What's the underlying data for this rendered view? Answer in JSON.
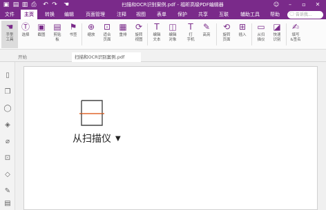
{
  "title_bar": {
    "title": "扫描和OCR识别案例.pdf - 福昕高级PDF编辑器",
    "quick_icons": [
      "app-logo-icon",
      "open-icon",
      "save-icon",
      "print-icon",
      "undo-icon",
      "redo-icon",
      "hand-icon"
    ],
    "window_controls": [
      "user-icon",
      "minimize-icon",
      "restore-icon",
      "close-icon"
    ]
  },
  "menu": {
    "items": [
      {
        "label": "文件",
        "active": false
      },
      {
        "label": "主页",
        "active": true
      },
      {
        "label": "转换",
        "active": false
      },
      {
        "label": "编辑",
        "active": false
      },
      {
        "label": "页面管理",
        "active": false
      },
      {
        "label": "注释",
        "active": false
      },
      {
        "label": "视图",
        "active": false
      },
      {
        "label": "表单",
        "active": false
      },
      {
        "label": "保护",
        "active": false
      },
      {
        "label": "共享",
        "active": false
      },
      {
        "label": "互联",
        "active": false
      },
      {
        "label": "辅助工具",
        "active": false
      },
      {
        "label": "帮助",
        "active": false
      }
    ],
    "search_placeholder": "告诉我..."
  },
  "ribbon": {
    "buttons": [
      {
        "icon": "hand-tool-icon",
        "label1": "手型",
        "label2": "工具",
        "selected": true
      },
      {
        "icon": "select-icon",
        "label1": "选择",
        "label2": "",
        "selected": false
      },
      {
        "icon": "snapshot-icon",
        "label1": "截图",
        "label2": "",
        "selected": false
      },
      {
        "icon": "clipboard-icon",
        "label1": "剪贴",
        "label2": "板",
        "selected": false
      },
      {
        "icon": "bookmark-icon",
        "label1": "书签",
        "label2": "",
        "selected": false
      },
      {
        "icon": "zoom-icon",
        "label1": "缩放",
        "label2": "",
        "selected": false
      },
      {
        "icon": "fit-page-icon",
        "label1": "适合",
        "label2": "页面",
        "selected": false
      },
      {
        "icon": "reflow-icon",
        "label1": "重排",
        "label2": "",
        "selected": false
      },
      {
        "icon": "rotate-view-icon",
        "label1": "旋转",
        "label2": "视图",
        "selected": false
      },
      {
        "icon": "edit-text-icon",
        "label1": "编辑",
        "label2": "文本",
        "selected": false
      },
      {
        "icon": "edit-object-icon",
        "label1": "编辑",
        "label2": "对象",
        "selected": false
      },
      {
        "icon": "typewriter-icon",
        "label1": "打",
        "label2": "字机",
        "selected": false
      },
      {
        "icon": "highlight-icon",
        "label1": "高亮",
        "label2": "",
        "selected": false
      },
      {
        "icon": "rotate-page-icon",
        "label1": "旋转",
        "label2": "页面",
        "selected": false
      },
      {
        "icon": "insert-icon",
        "label1": "插入",
        "label2": "",
        "selected": false
      },
      {
        "icon": "scanner-icon",
        "label1": "从扫",
        "label2": "描仪",
        "selected": false
      },
      {
        "icon": "quick-ocr-icon",
        "label1": "快速",
        "label2": "识别",
        "selected": false
      },
      {
        "icon": "fill-sign-icon",
        "label1": "填写",
        "label2": "&签名",
        "selected": false
      }
    ]
  },
  "tabs": [
    {
      "label": "开始",
      "active": false
    },
    {
      "label": "扫描和OCR识别案例.pdf",
      "active": true
    }
  ],
  "left_panel": {
    "icons": [
      "page-icon",
      "copy-icon",
      "comment-icon",
      "layers-icon",
      "attachment-icon",
      "lock-icon",
      "tag-icon",
      "signature-icon",
      "document-icon"
    ]
  },
  "document": {
    "scan_label": "从扫描仪"
  }
}
